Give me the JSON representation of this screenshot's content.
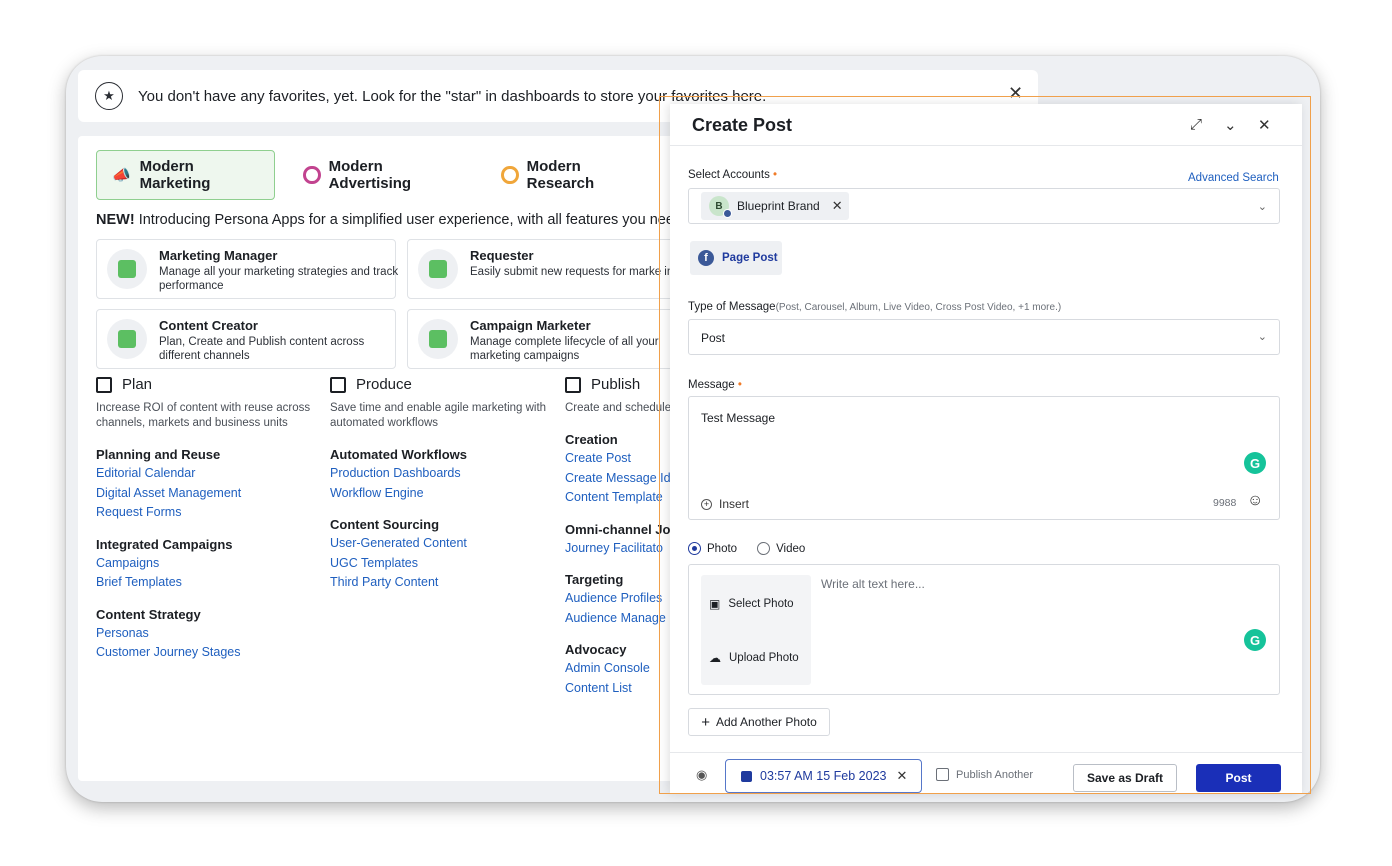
{
  "favorites": {
    "message": "You don't have any favorites, yet. Look for the \"star\" in dashboards to store your favorites here.",
    "close": "✕"
  },
  "tabs": [
    {
      "label": "Modern Marketing",
      "icon": "megaphone-icon",
      "color": "#5cbf62"
    },
    {
      "label": "Modern Advertising",
      "icon": "target-icon",
      "color": "#c2438f"
    },
    {
      "label": "Modern Research",
      "icon": "people-icon",
      "color": "#f0a63a"
    }
  ],
  "announcement": {
    "bold": "NEW!",
    "text": " Introducing Persona Apps for a simplified user experience, with all features you need"
  },
  "apps": [
    {
      "title": "Marketing Manager",
      "desc": "Manage all your marketing strategies and track performance"
    },
    {
      "title": "Requester",
      "desc": "Easily submit new requests for marke intake"
    },
    {
      "title": "Content Creator",
      "desc": "Plan, Create and Publish content across different channels"
    },
    {
      "title": "Campaign Marketer",
      "desc": "Manage complete lifecycle of all your marketing campaigns"
    }
  ],
  "columns": [
    {
      "title": "Plan",
      "desc": "Increase ROI of content with reuse across channels, markets and business units",
      "groups": [
        {
          "title": "Planning and Reuse",
          "links": [
            "Editorial Calendar",
            "Digital Asset Management",
            "Request Forms"
          ]
        },
        {
          "title": "Integrated Campaigns",
          "links": [
            "Campaigns",
            "Brief Templates"
          ]
        },
        {
          "title": "Content Strategy",
          "links": [
            "Personas",
            "Customer Journey Stages"
          ]
        }
      ]
    },
    {
      "title": "Produce",
      "desc": "Save time and enable agile marketing with automated workflows",
      "groups": [
        {
          "title": "Automated Workflows",
          "links": [
            "Production Dashboards",
            "Workflow Engine"
          ]
        },
        {
          "title": "Content Sourcing",
          "links": [
            "User-Generated Content",
            "UGC Templates",
            "Third Party Content"
          ]
        }
      ]
    },
    {
      "title": "Publish",
      "desc": "Create and schedule channels with enter",
      "groups": [
        {
          "title": "Creation",
          "links": [
            "Create Post",
            "Create Message Id",
            "Content Template"
          ]
        },
        {
          "title": "Omni-channel Jou",
          "links": [
            "Journey Facilitato"
          ]
        },
        {
          "title": "Targeting",
          "links": [
            "Audience Profiles",
            "Audience Manage"
          ]
        },
        {
          "title": "Advocacy",
          "links": [
            "Admin Console",
            "Content List"
          ]
        }
      ]
    }
  ],
  "panel": {
    "title": "Create Post",
    "select_accounts_label": "Select Accounts",
    "required_mark": "•",
    "advanced_search": "Advanced Search",
    "account": {
      "initial": "B",
      "name": "Blueprint Brand"
    },
    "page_post": "Page Post",
    "type_label": "Type of Message",
    "type_sub": "(Post, Carousel, Album, Live Video, Cross Post Video, +1 more.)",
    "type_value": "Post",
    "message_label": "Message",
    "message_value": "Test Message",
    "insert": "Insert",
    "char_count": "9988",
    "media_options": [
      "Photo",
      "Video"
    ],
    "select_photo": "Select Photo",
    "upload_photo": "Upload Photo",
    "alt_placeholder": "Write alt text here...",
    "add_photo": "Add Another Photo",
    "schedule": "03:57 AM 15 Feb 2023",
    "publish_another": "Publish Another",
    "save_draft": "Save as Draft",
    "post": "Post"
  }
}
